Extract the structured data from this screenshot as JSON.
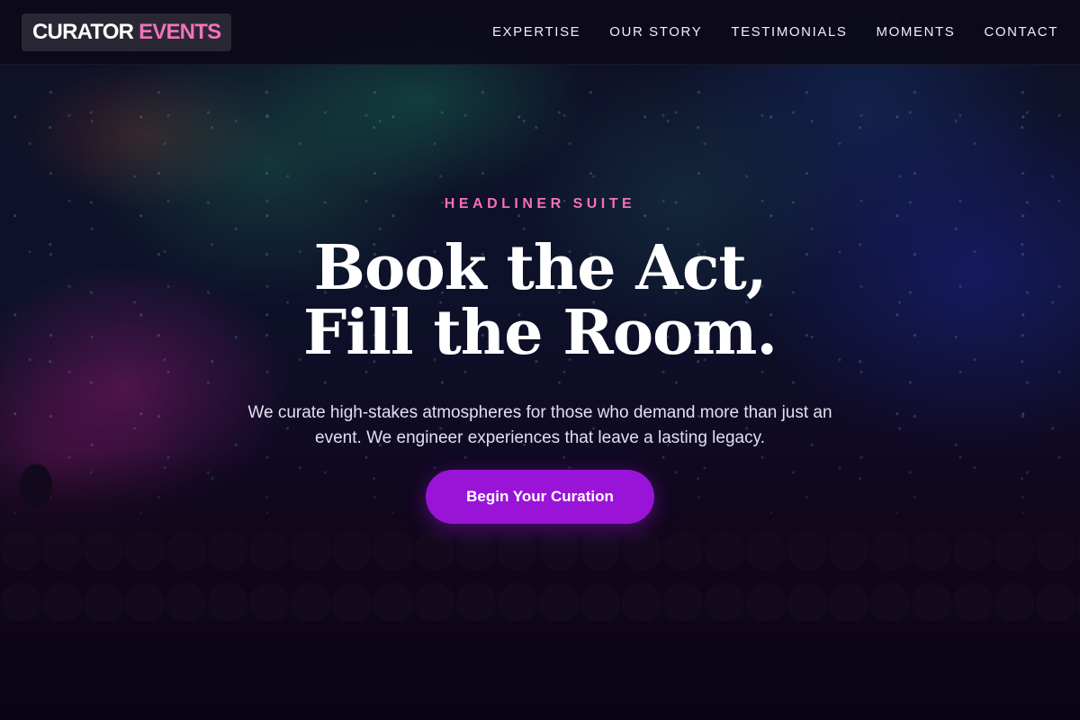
{
  "nav": {
    "logo_primary": "CURATOR",
    "logo_accent": "EVENTS",
    "links": [
      "EXPERTISE",
      "OUR STORY",
      "TESTIMONIALS",
      "MOMENTS",
      "CONTACT"
    ]
  },
  "hero": {
    "eyebrow": "HEADLINER SUITE",
    "headline_line1": "Book the Act,",
    "headline_line2": "Fill the Room.",
    "subtext": "We curate high-stakes atmospheres for those who demand more than just an event. We engineer experiences that leave a lasting legacy.",
    "cta_label": "Begin Your Curation"
  },
  "colors": {
    "accent_pink": "#f472b6",
    "cta_purple": "#9a14d8",
    "nav_bg": "#0c0a18"
  }
}
